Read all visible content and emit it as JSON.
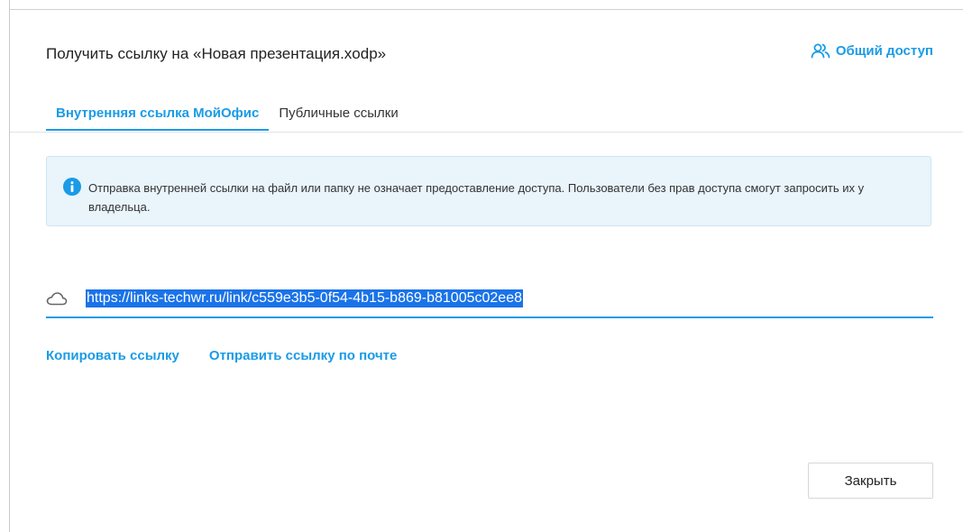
{
  "dialog": {
    "title": "Получить ссылку на «Новая презентация.xodp»",
    "share_label": "Общий доступ"
  },
  "tabs": [
    {
      "label": "Внутренняя ссылка МойОфис",
      "active": true
    },
    {
      "label": "Публичные ссылки",
      "active": false
    }
  ],
  "info": {
    "text": "Отправка внутренней ссылки на файл или папку не означает предоставление доступа. Пользователи без прав доступа смогут запросить их у владельца."
  },
  "link": {
    "url": "https://links-techwr.ru/link/c559e3b5-0f54-4b15-b869-b81005c02ee8"
  },
  "actions": {
    "copy_label": "Копировать ссылку",
    "email_label": "Отправить ссылку по почте"
  },
  "footer": {
    "close_label": "Закрыть"
  },
  "colors": {
    "accent": "#1a9be6",
    "selection": "#1a73e8",
    "info_background": "#e9f4fb"
  }
}
